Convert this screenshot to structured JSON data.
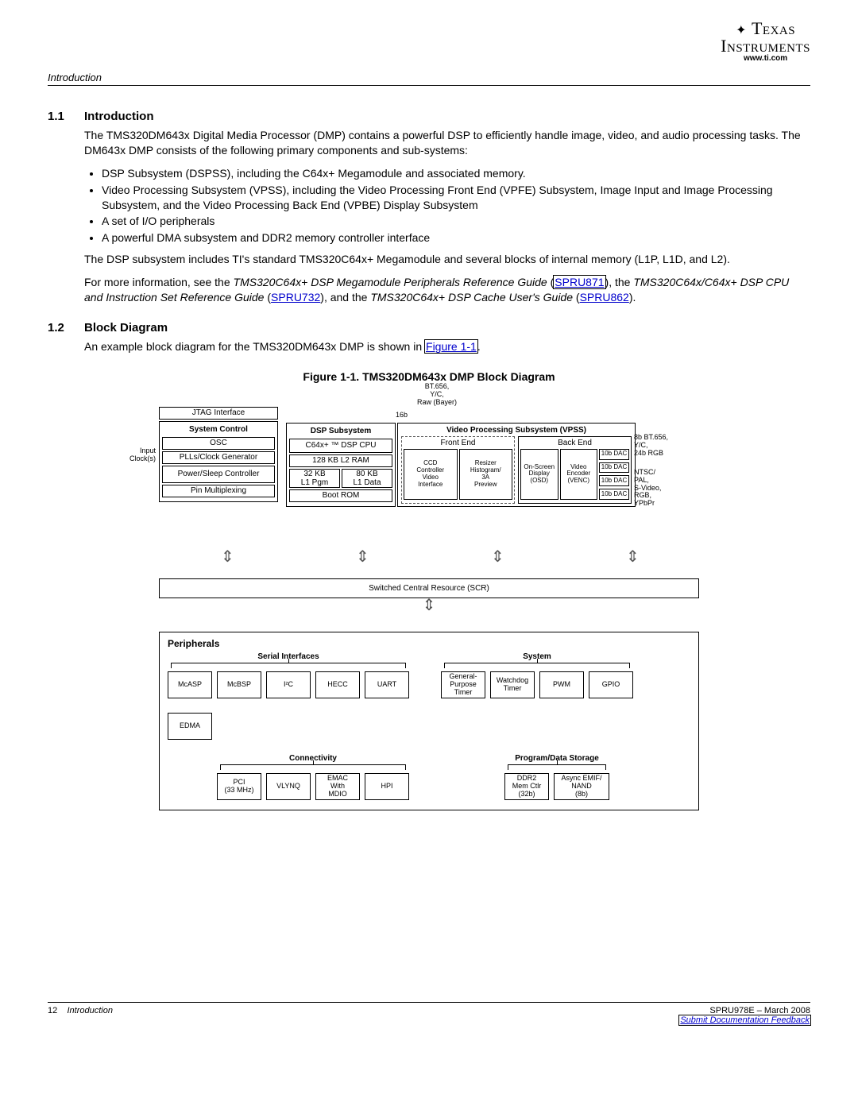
{
  "header": {
    "section": "Introduction",
    "logo_line1": "Texas",
    "logo_line2": "Instruments",
    "logo_url": "www.ti.com"
  },
  "s11": {
    "num": "1.1",
    "title": "Introduction",
    "p1": "The TMS320DM643x Digital Media Processor (DMP) contains a powerful DSP to efficiently handle image, video, and audio processing tasks. The DM643x DMP consists of the following primary components and sub-systems:",
    "b1": "DSP Subsystem (DSPSS), including the C64x+ Megamodule and associated memory.",
    "b2": "Video Processing Subsystem (VPSS), including the Video Processing Front End (VPFE) Subsystem, Image Input and Image Processing Subsystem, and the Video Processing Back End (VPBE) Display Subsystem",
    "b3": "A set of I/O peripherals",
    "b4": "A powerful DMA subsystem and DDR2 memory controller interface",
    "p2": "The DSP subsystem includes TI's standard TMS320C64x+ Megamodule and several blocks of internal memory (L1P, L1D, and L2).",
    "p3a": "For more information, see the ",
    "p3b": "TMS320C64x+ DSP Megamodule Peripherals Reference Guide",
    "p3c": " (",
    "link1": "SPRU871",
    "p3d": "), the ",
    "p3e": "TMS320C64x/C64x+ DSP CPU and Instruction Set Reference Guide",
    "p3f": " (",
    "link2": "SPRU732",
    "p3g": "), and the ",
    "p3h": "TMS320C64x+ DSP Cache User's Guide",
    "p3i": " (",
    "link3": "SPRU862",
    "p3j": ")."
  },
  "s12": {
    "num": "1.2",
    "title": "Block Diagram",
    "p1a": "An example block diagram for the TMS320DM643x DMP is shown in ",
    "figlink": "Figure 1-1",
    "p1b": "."
  },
  "fig": {
    "caption": "Figure 1-1. TMS320DM643x DMP Block Diagram",
    "top_in": "BT.656,\nY/C,\nRaw (Bayer)",
    "bit16": "16b",
    "input_clk": "Input\nClock(s)",
    "jtag": "JTAG Interface",
    "syshead": "System Control",
    "osc": "OSC",
    "plls": "PLLs/Clock Generator",
    "pwr": "Power/Sleep Controller",
    "pinmux": "Pin Multiplexing",
    "dsphead": "DSP Subsystem",
    "c64x": "C64x+ ™ DSP CPU",
    "l2": "128 KB L2 RAM",
    "l1p": "32 KB\nL1 Pgm",
    "l1d": "80 KB\nL1 Data",
    "bootrom": "Boot ROM",
    "vpss_head": "Video Processing Subsystem (VPSS)",
    "fe": "Front End",
    "be": "Back End",
    "ccd": "CCD\nController\nVideo\nInterface",
    "resizer": "Resizer\nHistogram/\n3A\nPreview",
    "osd": "On-Screen\nDisplay\n(OSD)",
    "venc": "Video\nEncoder\n(VENC)",
    "dac": "10b DAC",
    "right1": "8b BT.656,\nY/C,\n24b RGB",
    "right2": "NTSC/\nPAL,\nS-Video,\nRGB,\nYPbPr",
    "scr": "Switched Central Resource (SCR)",
    "periph": "Peripherals",
    "serial": "Serial Interfaces",
    "system": "System",
    "mcasp": "McASP",
    "mcbsp": "McBSP",
    "i2c": "I²C",
    "hecc": "HECC",
    "uart": "UART",
    "gpt": "General-\nPurpose\nTimer",
    "wdt": "Watchdog\nTimer",
    "pwm": "PWM",
    "gpio": "GPIO",
    "edma": "EDMA",
    "conn": "Connectivity",
    "pds": "Program/Data Storage",
    "pci": "PCI\n(33 MHz)",
    "vlynq": "VLYNQ",
    "emac": "EMAC\nWith\nMDIO",
    "hpi": "HPI",
    "ddr2": "DDR2\nMem Ctlr\n(32b)",
    "aemif": "Async EMIF/\nNAND\n(8b)"
  },
  "footer": {
    "page": "12",
    "title": "Introduction",
    "docid": "SPRU978E – March 2008",
    "feedback": "Submit Documentation Feedback"
  }
}
